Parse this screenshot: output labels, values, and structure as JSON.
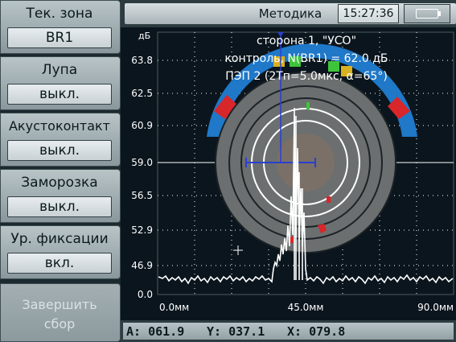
{
  "sidebar": {
    "items": [
      {
        "label": "Тек. зона",
        "value": "BR1"
      },
      {
        "label": "Лупа",
        "value": "выкл."
      },
      {
        "label": "Акустоконтакт",
        "value": "выкл."
      },
      {
        "label": "Заморозка",
        "value": "выкл."
      },
      {
        "label": "Ур. фиксации",
        "value": "вкл."
      }
    ],
    "finish": {
      "line1": "Завершить",
      "line2": "сбор"
    }
  },
  "topbar": {
    "title": "Методика",
    "clock": "15:27:36"
  },
  "plot": {
    "y_unit": "дБ",
    "y_ticks": [
      "63.8",
      "62.5",
      "60.9",
      "59.0",
      "56.5",
      "52.9",
      "46.9",
      "0.0"
    ],
    "x_ticks": [
      "0.0мм",
      "45.0мм",
      "90.0мм"
    ],
    "info_lines": [
      "сторона 1, \"УСО\"",
      "контроль, N(BR1) = 62.0 дБ",
      "ПЭП 2 (2Тп=5.0мкс, α=65°)"
    ]
  },
  "readout": {
    "a": "A: 061.9",
    "y": "Y: 037.1",
    "x": "X: 079.8"
  },
  "colors": {
    "plot_bg": "#0b151d",
    "grid": "#ffffff",
    "trace": "#ffffff",
    "zone_blue": "#1f78c8",
    "zone_red": "#d8262a",
    "zone_green": "#3ec43a",
    "cursor_blue": "#2a3fd0",
    "disk": "#6b6f6f"
  }
}
